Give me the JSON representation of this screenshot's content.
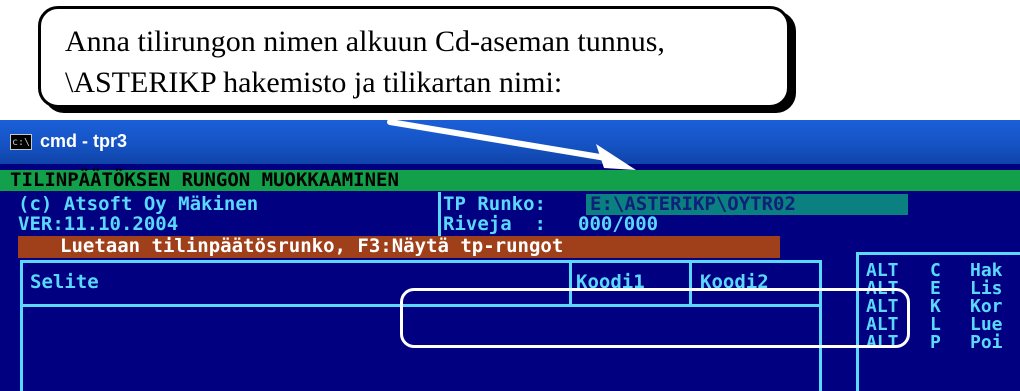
{
  "callout": {
    "line1": "Anna tilirungon nimen alkuun Cd-aseman tunnus,",
    "line2": "\\ASTERIKP hakemisto ja tilikartan nimi:"
  },
  "window": {
    "icon_text": "c:\\",
    "title": "cmd - tpr3"
  },
  "console": {
    "title": "TILINPÄÄTÖKSEN RUNGON MUOKKAAMINEN",
    "copyright": "(c) Atsoft Oy Mäkinen",
    "version": "VER:11.10.2004",
    "runko_label": "TP Runko:",
    "runko_value": "E:\\ASTERIKP\\OYTR02",
    "rivi_label": "Riveja  :",
    "rivi_value": "000/000",
    "status": "Luetaan tilinpäätösrunko, F3:Näytä tp-rungot",
    "columns": [
      "Selite",
      "Koodi1",
      "Koodi2"
    ],
    "shortcuts": [
      {
        "mod": "ALT",
        "key": "C",
        "label": "Hak"
      },
      {
        "mod": "ALT",
        "key": "E",
        "label": "Lis"
      },
      {
        "mod": "ALT",
        "key": "K",
        "label": "Kor"
      },
      {
        "mod": "ALT",
        "key": "L",
        "label": "Lue"
      },
      {
        "mod": "ALT",
        "key": "P",
        "label": "Poi"
      }
    ]
  },
  "colors": {
    "console_bg": "#000080",
    "cyan_text": "#5ad8ff",
    "green_bar": "#12a04a",
    "status_bar": "#a0401a",
    "field_bg": "#0a8080"
  }
}
